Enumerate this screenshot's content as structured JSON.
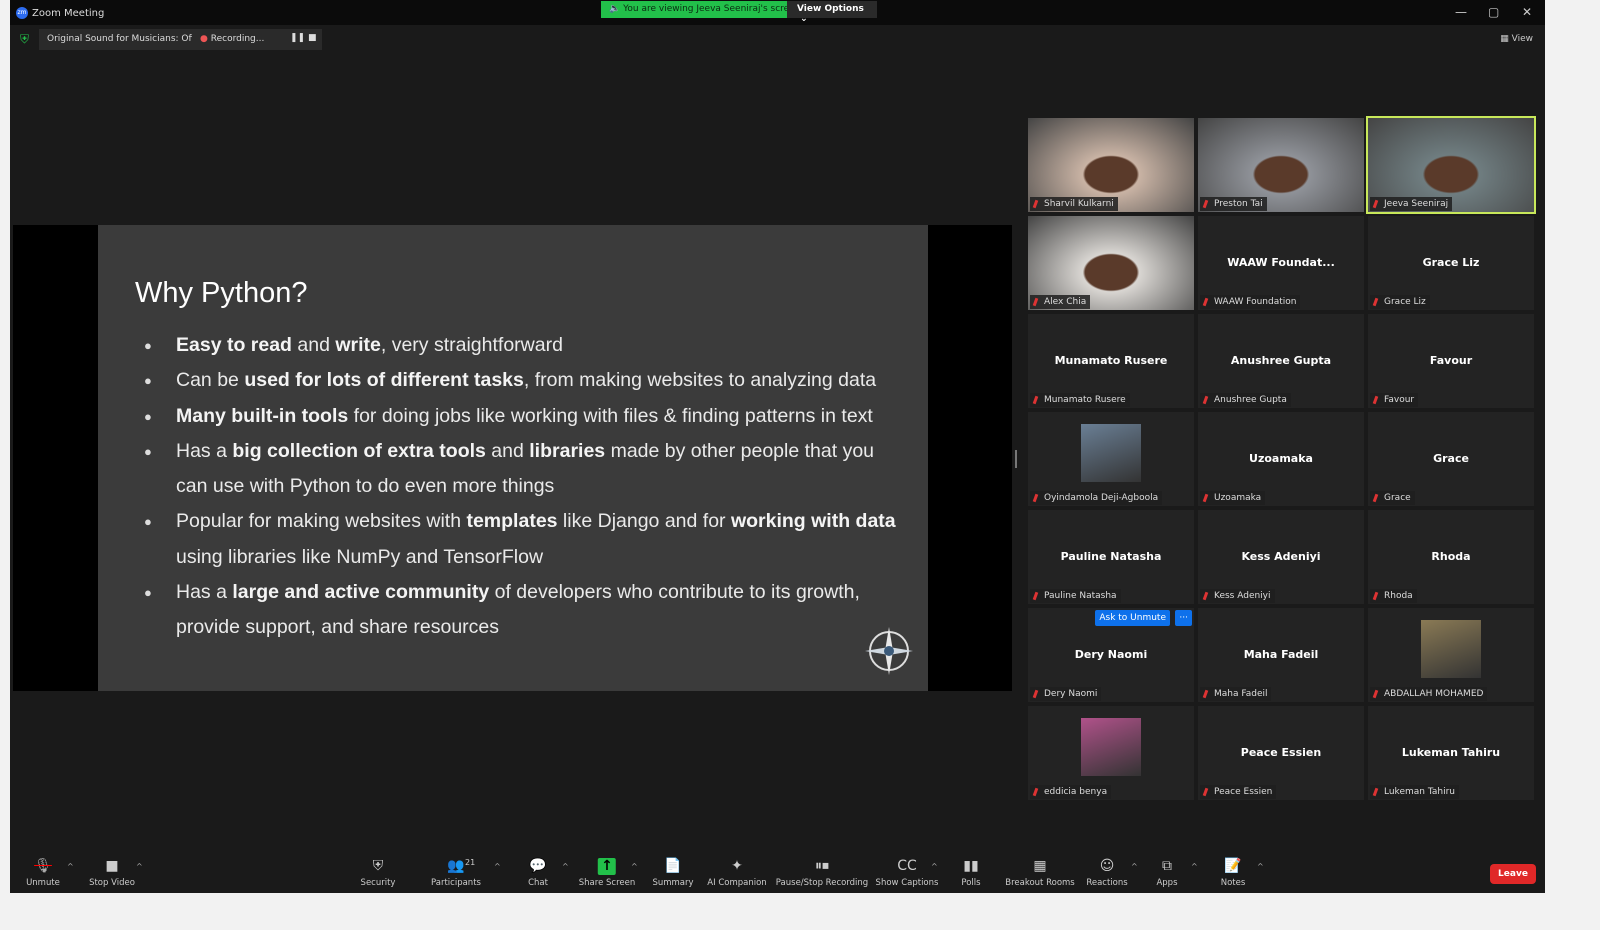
{
  "window": {
    "title": "Zoom Meeting",
    "logo": "zm"
  },
  "banner": {
    "viewing": "You are viewing Jeeva Seeniraj's screen",
    "view_options": "View Options"
  },
  "infobar": {
    "sound": "Original Sound for Musicians: Off",
    "recording": "Recording...",
    "view": "View"
  },
  "slide": {
    "title": "Why Python?",
    "bullets": [
      [
        {
          "t": "Easy to read",
          "b": true
        },
        {
          "t": " and "
        },
        {
          "t": "write",
          "b": true
        },
        {
          "t": ", very straightforward"
        }
      ],
      [
        {
          "t": "Can be "
        },
        {
          "t": "used for lots of different tasks",
          "b": true
        },
        {
          "t": ", from making websites to analyzing data"
        }
      ],
      [
        {
          "t": "Many built-in tools",
          "b": true
        },
        {
          "t": " for doing jobs like working with files & finding patterns in text"
        }
      ],
      [
        {
          "t": "Has a "
        },
        {
          "t": "big collection of extra tools",
          "b": true
        },
        {
          "t": " and "
        },
        {
          "t": "libraries",
          "b": true
        },
        {
          "t": " made by other people that you can use with Python to do even more things"
        }
      ],
      [
        {
          "t": "Popular for making websites with "
        },
        {
          "t": "templates",
          "b": true
        },
        {
          "t": " like Django and for "
        },
        {
          "t": "working with data",
          "b": true
        },
        {
          "t": " using libraries like NumPy and TensorFlow"
        }
      ],
      [
        {
          "t": "Has a "
        },
        {
          "t": "large and active community",
          "b": true
        },
        {
          "t": " of developers who contribute to its growth, provide support, and share resources"
        }
      ]
    ]
  },
  "participants": [
    {
      "name": "Sharvil Kulkarni",
      "type": "video",
      "color": "#c9b3a4"
    },
    {
      "name": "Preston Tai",
      "type": "video",
      "color": "#8f9298"
    },
    {
      "name": "Jeeva Seeniraj",
      "type": "video",
      "color": "#6f7d80",
      "active": true
    },
    {
      "name": "Alex Chia",
      "type": "video",
      "color": "#d9d6d2"
    },
    {
      "name": "WAAW Foundation",
      "display": "WAAW  Foundat...",
      "type": "name"
    },
    {
      "name": "Grace Liz",
      "display": "Grace Liz",
      "type": "name"
    },
    {
      "name": "Munamato Rusere",
      "display": "Munamato Rusere",
      "type": "name"
    },
    {
      "name": "Anushree Gupta",
      "display": "Anushree Gupta",
      "type": "name"
    },
    {
      "name": "Favour",
      "display": "Favour",
      "type": "name"
    },
    {
      "name": "Oyindamola Deji-Agboola",
      "type": "avatar",
      "color": "#6a7f95"
    },
    {
      "name": "Uzoamaka",
      "display": "Uzoamaka",
      "type": "name"
    },
    {
      "name": "Grace",
      "display": "Grace",
      "type": "name"
    },
    {
      "name": "Pauline Natasha",
      "display": "Pauline Natasha",
      "type": "name"
    },
    {
      "name": "Kess Adeniyi",
      "display": "Kess Adeniyi",
      "type": "name"
    },
    {
      "name": "Rhoda",
      "display": "Rhoda",
      "type": "name"
    },
    {
      "name": "Dery Naomi",
      "display": "Dery Naomi",
      "type": "name",
      "ask_unmute": "Ask to Unmute",
      "more": "···"
    },
    {
      "name": "Maha Fadeil",
      "display": "Maha Fadeil",
      "type": "name"
    },
    {
      "name": "ABDALLAH MOHAMED",
      "type": "avatar",
      "color": "#8a7a55"
    },
    {
      "name": "eddicia benya",
      "type": "avatar",
      "color": "#b0528a"
    },
    {
      "name": "Peace Essien",
      "display": "Peace Essien",
      "type": "name"
    },
    {
      "name": "Lukeman Tahiru",
      "display": "Lukeman Tahiru",
      "type": "name"
    }
  ],
  "toolbar": [
    {
      "label": "Unmute",
      "icon": "mic-muted-icon",
      "glyph": "🎙",
      "caret": true
    },
    {
      "label": "Stop Video",
      "icon": "video-camera-icon",
      "glyph": "■",
      "caret": true
    },
    {
      "label": "Security",
      "icon": "shield-icon",
      "glyph": "⛨"
    },
    {
      "label": "Participants",
      "icon": "participants-icon",
      "glyph": "👥",
      "count": "21",
      "caret": true
    },
    {
      "label": "Chat",
      "icon": "chat-icon",
      "glyph": "💬",
      "caret": true
    },
    {
      "label": "Share Screen",
      "icon": "share-screen-icon",
      "glyph": "↑",
      "caret": true,
      "accent": "#22c04a"
    },
    {
      "label": "Summary",
      "icon": "summary-icon",
      "glyph": "📄"
    },
    {
      "label": "AI Companion",
      "icon": "sparkle-icon",
      "glyph": "✦"
    },
    {
      "label": "Pause/Stop Recording",
      "icon": "pause-stop-icon",
      "glyph": "⏸⏹"
    },
    {
      "label": "Show Captions",
      "icon": "captions-icon",
      "glyph": "CC",
      "caret": true
    },
    {
      "label": "Polls",
      "icon": "polls-icon",
      "glyph": "▮▮"
    },
    {
      "label": "Breakout Rooms",
      "icon": "breakout-rooms-icon",
      "glyph": "▦"
    },
    {
      "label": "Reactions",
      "icon": "reactions-icon",
      "glyph": "☺",
      "caret": true
    },
    {
      "label": "Apps",
      "icon": "apps-icon",
      "glyph": "⧉",
      "caret": true
    },
    {
      "label": "Notes",
      "icon": "notes-icon",
      "glyph": "📝",
      "caret": true
    }
  ],
  "leave": "Leave"
}
